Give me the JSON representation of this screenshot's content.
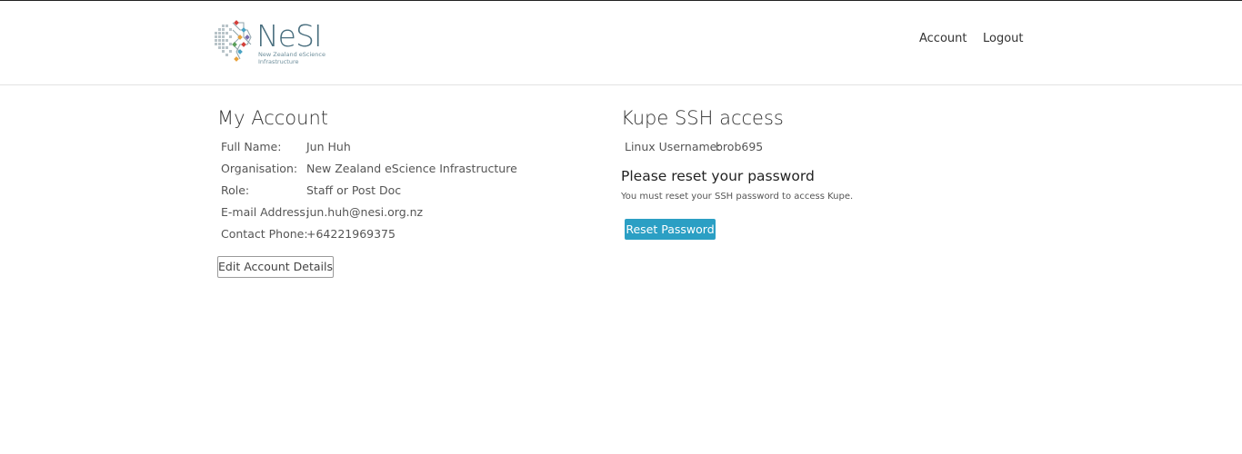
{
  "logo": {
    "name": "NeSI",
    "subtitle": "New Zealand eScience Infrastructure",
    "colors": [
      "#d43f3a",
      "#e8a13a",
      "#4aa3c4",
      "#5aa05a",
      "#7a6fb0"
    ]
  },
  "nav": {
    "account": "Account",
    "logout": "Logout"
  },
  "account": {
    "title": "My Account",
    "fields": [
      {
        "label": "Full Name:",
        "value": "Jun Huh"
      },
      {
        "label": "Organisation:",
        "value": "New Zealand eScience Infrastructure"
      },
      {
        "label": "Role:",
        "value": "Staff or Post Doc"
      },
      {
        "label": "E-mail Address:",
        "value": "jun.huh@nesi.org.nz"
      },
      {
        "label": "Contact Phone:",
        "value": "+64221969375"
      }
    ],
    "edit_button": "Edit Account Details"
  },
  "ssh": {
    "title": "Kupe SSH access",
    "username_label": "Linux Username:",
    "username_value": "brob695",
    "reset_heading": "Please reset your password",
    "reset_note": "You must reset your SSH password to access Kupe.",
    "reset_button": "Reset Password",
    "accent": "#2b9fc4"
  }
}
